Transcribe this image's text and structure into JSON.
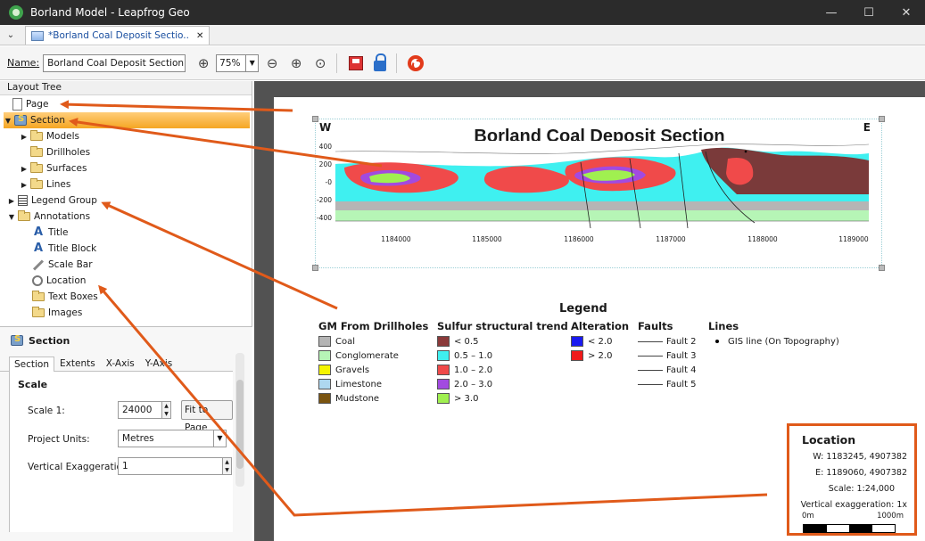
{
  "window": {
    "title": "Borland Model - Leapfrog Geo",
    "minimize": "—",
    "maximize": "☐",
    "close": "✕"
  },
  "tabbar": {
    "chevron": "⌄",
    "tab_label": "*Borland Coal Deposit Sectio..",
    "tab_close": "✕"
  },
  "toolbar": {
    "name_label": "Name:",
    "name_value": "Borland Coal Deposit Section Layo",
    "zoom_value": "75%",
    "zoom_in_glyph": "⊕",
    "zoom_out_glyph": "⊖",
    "zoom_fit_glyph": "⊕",
    "zoom_page_glyph": "⊙"
  },
  "tree": {
    "header": "Layout Tree",
    "items": [
      {
        "label": "Page",
        "icon": "page-icon"
      },
      {
        "label": "Section",
        "icon": "section-icon"
      },
      {
        "label": "Models",
        "icon": "folder-icon"
      },
      {
        "label": "Drillholes",
        "icon": "folder-icon"
      },
      {
        "label": "Surfaces",
        "icon": "folder-icon"
      },
      {
        "label": "Lines",
        "icon": "folder-icon"
      },
      {
        "label": "Legend Group",
        "icon": "legend-icon"
      },
      {
        "label": "Annotations",
        "icon": "folder-icon"
      },
      {
        "label": "Title",
        "icon": "title-icon"
      },
      {
        "label": "Title Block",
        "icon": "title-icon"
      },
      {
        "label": "Scale Bar",
        "icon": "scale-bar-icon"
      },
      {
        "label": "Location",
        "icon": "location-icon"
      },
      {
        "label": "Text Boxes",
        "icon": "folder-icon"
      },
      {
        "label": "Images",
        "icon": "folder-icon"
      }
    ]
  },
  "properties": {
    "title": "Section",
    "tabs": [
      "Section",
      "Extents",
      "X-Axis",
      "Y-Axis"
    ],
    "group": "Scale",
    "scale_label": "Scale 1:",
    "scale_value": "24000",
    "fit_button": "Fit to Page",
    "units_label": "Project Units:",
    "units_value": "Metres",
    "vex_label": "Vertical Exaggeration:",
    "vex_value": "1"
  },
  "section": {
    "west": "W",
    "east": "E",
    "title": "Borland Coal Deposit Section",
    "y_ticks": [
      "400",
      "200",
      "-0",
      "-200",
      "-400"
    ],
    "x_ticks": [
      "1184000",
      "1185000",
      "1186000",
      "1187000",
      "1188000",
      "1189000"
    ]
  },
  "legend": {
    "title": "Legend",
    "gm": {
      "heading": "GM From Drillholes",
      "items": [
        {
          "label": "Coal",
          "color": "#b5b5b5"
        },
        {
          "label": "Conglomerate",
          "color": "#b6f5b6"
        },
        {
          "label": "Gravels",
          "color": "#f5f500"
        },
        {
          "label": "Limestone",
          "color": "#aed8f0"
        },
        {
          "label": "Mudstone",
          "color": "#7a5410"
        }
      ]
    },
    "sulfur": {
      "heading": "Sulfur structural trend",
      "items": [
        {
          "label": "< 0.5",
          "color": "#8a3a3a"
        },
        {
          "label": "0.5 – 1.0",
          "color": "#3ff0f0"
        },
        {
          "label": "1.0 – 2.0",
          "color": "#f04a4a"
        },
        {
          "label": "2.0 – 3.0",
          "color": "#a24ae0"
        },
        {
          "label": "> 3.0",
          "color": "#a0f050"
        }
      ]
    },
    "alteration": {
      "heading": "Alteration",
      "items": [
        {
          "label": "< 2.0",
          "color": "#1a1af0"
        },
        {
          "label": "> 2.0",
          "color": "#f01a1a"
        }
      ]
    },
    "faults": {
      "heading": "Faults",
      "items": [
        "Fault 2",
        "Fault 3",
        "Fault 4",
        "Fault 5"
      ]
    },
    "lines": {
      "heading": "Lines",
      "items": [
        "GIS line (On Topography)"
      ]
    }
  },
  "location": {
    "title": "Location",
    "w": "W:  1183245, 4907382",
    "e": "E:  1189060, 4907382",
    "scale": "Scale: 1:24,000",
    "vex": "Vertical exaggeration: 1x",
    "bar_start": "0m",
    "bar_end": "1000m"
  },
  "colors": {
    "accent_arrow": "#e05a1a",
    "selection": "#f5a623"
  }
}
